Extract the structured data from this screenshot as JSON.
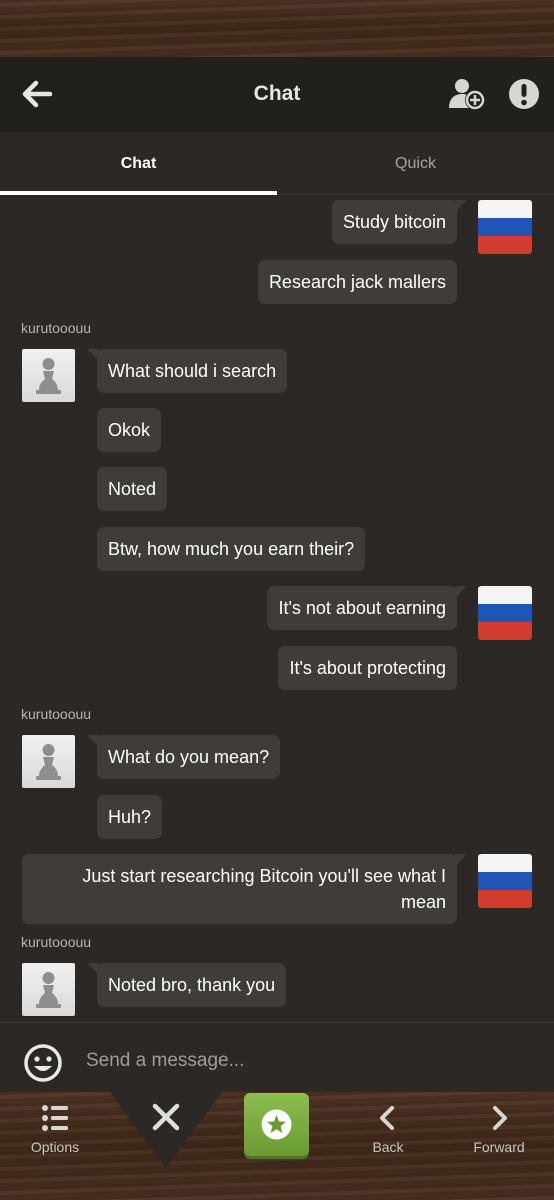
{
  "header": {
    "title": "Chat",
    "back_icon": "arrow-left-icon",
    "add_friend_icon": "add-friend-icon",
    "report_icon": "alert-icon"
  },
  "tabs": [
    {
      "label": "Chat",
      "active": true
    },
    {
      "label": "Quick",
      "active": false
    }
  ],
  "conversation": {
    "other_username": "kurutooouu",
    "messages": [
      {
        "from": "me",
        "text": "Study bitcoin"
      },
      {
        "from": "me",
        "text": "Research jack mallers"
      },
      {
        "from": "them",
        "text": "What should i search"
      },
      {
        "from": "them",
        "text": "Okok"
      },
      {
        "from": "them",
        "text": "Noted"
      },
      {
        "from": "them",
        "text": "Btw, how much you earn their?"
      },
      {
        "from": "me",
        "text": "It's not about earning"
      },
      {
        "from": "me",
        "text": "It's about protecting"
      },
      {
        "from": "them",
        "text": "What do you mean?"
      },
      {
        "from": "them",
        "text": "Huh?"
      },
      {
        "from": "me",
        "text": "Just start researching Bitcoin you'll see what I mean"
      },
      {
        "from": "them",
        "text": "Noted bro, thank you"
      }
    ]
  },
  "input": {
    "placeholder": "Send a message..."
  },
  "toolbar": {
    "options_label": "Options",
    "back_label": "Back",
    "forward_label": "Forward"
  },
  "colors": {
    "background": "#2b2825",
    "header": "#22201d",
    "bubble": "#403d39",
    "accent_green": "#7fb044",
    "flag_white": "#f4f4f4",
    "flag_blue": "#1f56b5",
    "flag_red": "#d23b2e"
  }
}
